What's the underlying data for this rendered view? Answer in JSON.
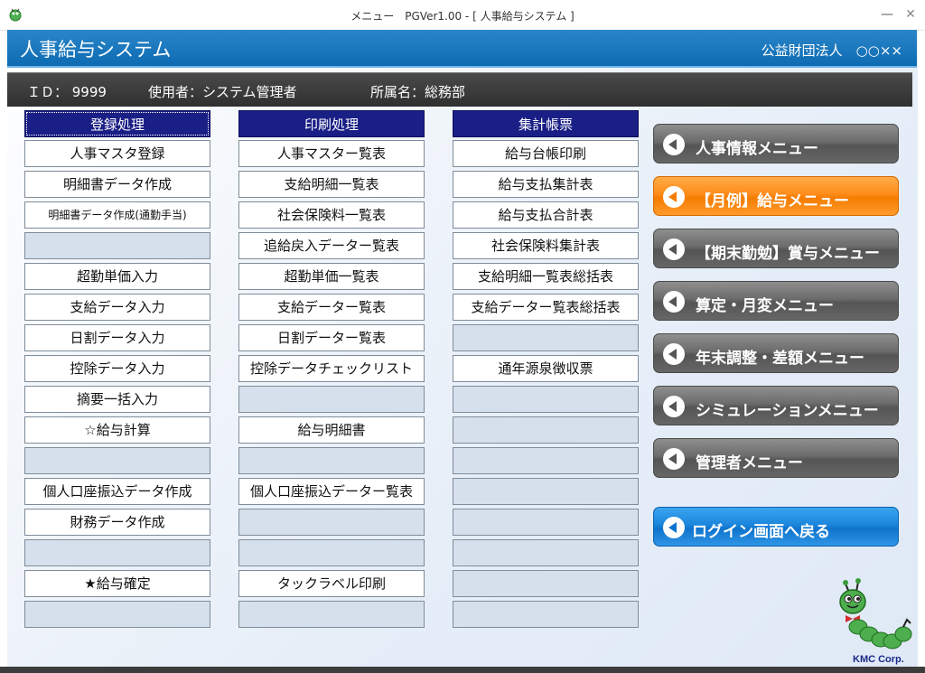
{
  "window": {
    "title": "メニュー　PGVer1.00 - [ 人事給与システム ]",
    "min_glyph": "—",
    "close_glyph": "✕"
  },
  "header": {
    "app_title": "人事給与システム",
    "org": "公益財団法人　○○××"
  },
  "info": {
    "id": "ＩＤ：  9999",
    "user": "使用者：システム管理者",
    "dept": "所属名：総務部"
  },
  "columns": [
    {
      "header": "登録処理",
      "items": [
        "人事マスタ登録",
        "明細書データ作成",
        "明細書データ作成(通勤手当)",
        "",
        "超勤単価入力",
        "支給データ入力",
        "日割データ入力",
        "控除データ入力",
        "摘要一括入力",
        "☆給与計算",
        "",
        "個人口座振込データ作成",
        "財務データ作成",
        "",
        "★給与確定",
        ""
      ]
    },
    {
      "header": "印刷処理",
      "items": [
        "人事マスター覧表",
        "支給明細一覧表",
        "社会保険料一覧表",
        "追給戻入データー覧表",
        "超勤単価一覧表",
        "支給データー覧表",
        "日割データー覧表",
        "控除データチェックリスト",
        "",
        "給与明細書",
        "",
        "個人口座振込データー覧表",
        "",
        "",
        "タックラベル印刷",
        ""
      ]
    },
    {
      "header": "集計帳票",
      "items": [
        "給与台帳印刷",
        "給与支払集計表",
        "給与支払合計表",
        "社会保険料集計表",
        "支給明細一覧表総括表",
        "支給データー覧表総括表",
        "",
        "通年源泉徴収票",
        "",
        "",
        "",
        "",
        "",
        "",
        "",
        ""
      ]
    }
  ],
  "menu": [
    {
      "label": "人事情報メニュー",
      "style": "gray"
    },
    {
      "label": "【月例】給与メニュー",
      "style": "active"
    },
    {
      "label": "【期末勤勉】賞与メニュー",
      "style": "gray"
    },
    {
      "label": "算定・月変メニュー",
      "style": "gray"
    },
    {
      "label": "年末調整・差額メニュー",
      "style": "gray"
    },
    {
      "label": "シミュレーションメニュー",
      "style": "gray"
    },
    {
      "label": "管理者メニュー",
      "style": "gray"
    },
    {
      "label": "ログイン画面へ戻る",
      "style": "blue"
    }
  ],
  "logo": {
    "text": "KMC Corp."
  },
  "colors": {
    "header_blue": "#0d6bb3",
    "column_header_navy": "#1a1f86",
    "active_orange": "#f57c00",
    "empty_cell": "#d6e0ec"
  }
}
